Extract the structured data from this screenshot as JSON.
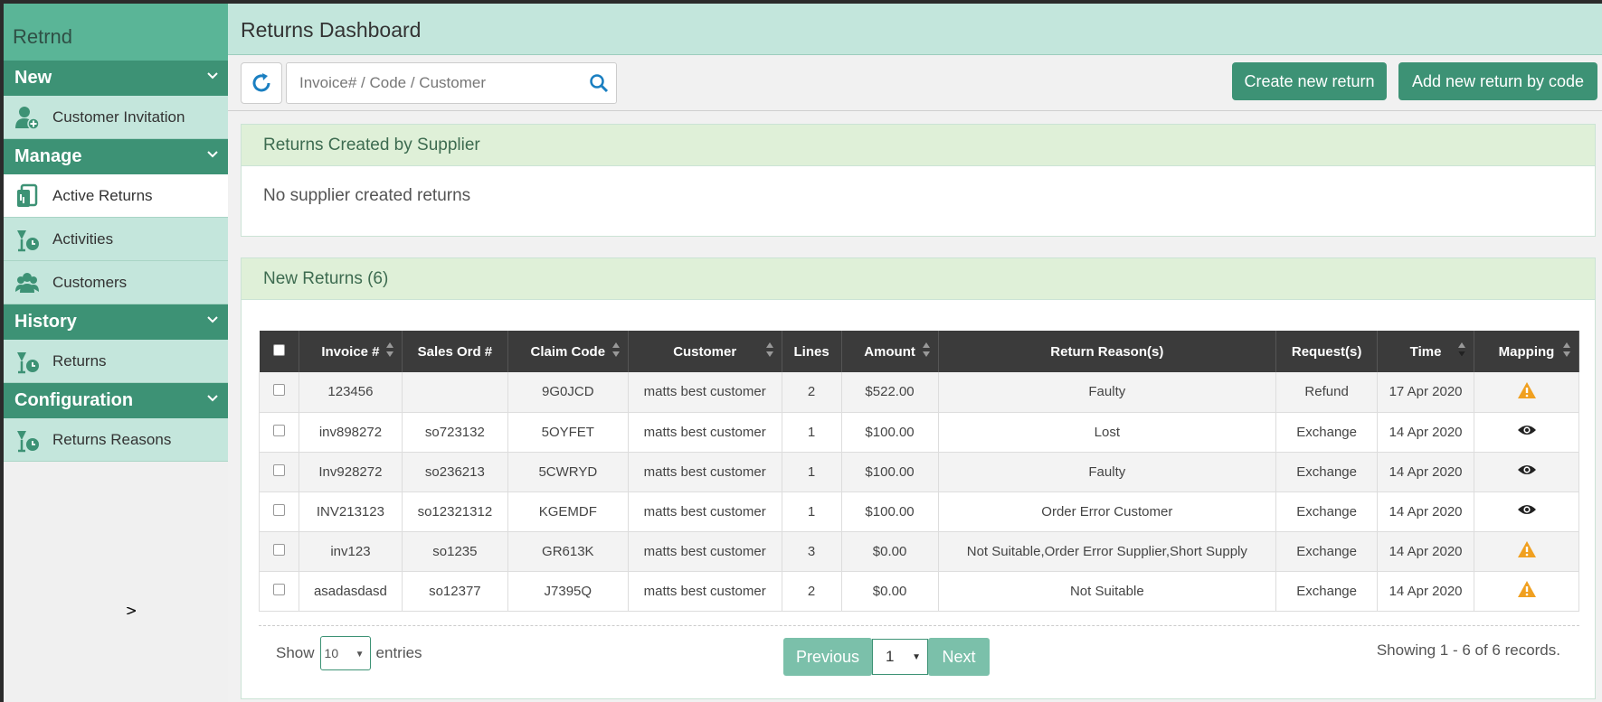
{
  "sidebar": {
    "brand": "Retrnd",
    "sections": [
      {
        "title": "New",
        "items": [
          {
            "label": "Customer Invitation",
            "icon": "user-plus-icon"
          }
        ]
      },
      {
        "title": "Manage",
        "items": [
          {
            "label": "Active Returns",
            "icon": "returns-icon"
          },
          {
            "label": "Activities",
            "icon": "activities-icon"
          },
          {
            "label": "Customers",
            "icon": "customers-icon"
          }
        ]
      },
      {
        "title": "History",
        "items": [
          {
            "label": "Returns",
            "icon": "history-returns-icon"
          }
        ]
      },
      {
        "title": "Configuration",
        "items": [
          {
            "label": "Returns Reasons",
            "icon": "reasons-icon"
          }
        ]
      }
    ]
  },
  "header": {
    "title": "Returns Dashboard"
  },
  "toolbar": {
    "search_placeholder": "Invoice# / Code / Customer",
    "create_label": "Create new return",
    "add_by_code_label": "Add new return by code"
  },
  "supplier_panel": {
    "title": "Returns Created by Supplier",
    "empty_text": "No supplier created returns"
  },
  "returns_panel": {
    "title": "New Returns (6)",
    "columns": [
      "Invoice #",
      "Sales Ord #",
      "Claim Code",
      "Customer",
      "Lines",
      "Amount",
      "Return Reason(s)",
      "Request(s)",
      "Time",
      "Mapping"
    ],
    "rows": [
      {
        "invoice": "123456",
        "sales_ord": "",
        "claim": "9G0JCD",
        "customer": "matts best customer",
        "lines": "2",
        "amount": "$522.00",
        "reason": "Faulty",
        "request": "Refund",
        "time": "17 Apr 2020",
        "mapping": "warning"
      },
      {
        "invoice": "inv898272",
        "sales_ord": "so723132",
        "claim": "5OYFET",
        "customer": "matts best customer",
        "lines": "1",
        "amount": "$100.00",
        "reason": "Lost",
        "request": "Exchange",
        "time": "14 Apr 2020",
        "mapping": "view"
      },
      {
        "invoice": "Inv928272",
        "sales_ord": "so236213",
        "claim": "5CWRYD",
        "customer": "matts best customer",
        "lines": "1",
        "amount": "$100.00",
        "reason": "Faulty",
        "request": "Exchange",
        "time": "14 Apr 2020",
        "mapping": "view"
      },
      {
        "invoice": "INV213123",
        "sales_ord": "so12321312",
        "claim": "KGEMDF",
        "customer": "matts best customer",
        "lines": "1",
        "amount": "$100.00",
        "reason": "Order Error Customer",
        "request": "Exchange",
        "time": "14 Apr 2020",
        "mapping": "view"
      },
      {
        "invoice": "inv123",
        "sales_ord": "so1235",
        "claim": "GR613K",
        "customer": "matts best customer",
        "lines": "3",
        "amount": "$0.00",
        "reason": "Not Suitable,Order Error Supplier,Short Supply",
        "request": "Exchange",
        "time": "14 Apr 2020",
        "mapping": "warning"
      },
      {
        "invoice": "asadasdasd",
        "sales_ord": "so12377",
        "claim": "J7395Q",
        "customer": "matts best customer",
        "lines": "2",
        "amount": "$0.00",
        "reason": "Not Suitable",
        "request": "Exchange",
        "time": "14 Apr 2020",
        "mapping": "warning"
      }
    ],
    "show_label": "Show",
    "entries_value": "10",
    "entries_label": "entries",
    "prev_label": "Previous",
    "page_value": "1",
    "next_label": "Next",
    "showing_text": "Showing 1 - 6 of 6 records."
  },
  "colors": {
    "accent": "#3d9275",
    "brand_bg": "#5ab597",
    "warning": "#f0a020"
  }
}
